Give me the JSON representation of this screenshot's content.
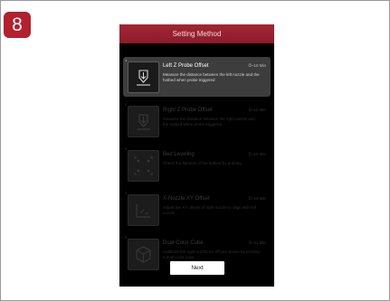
{
  "step_badge": "8",
  "colors": {
    "accent": "#b3202e",
    "topbar": "#9e2232",
    "device_bg": "#000000",
    "active_item": "#3d3d3d"
  },
  "screen": {
    "title": "Setting Method",
    "items": [
      {
        "number": "1",
        "title": "Left Z Probe Offset",
        "time": "⏱~10 Min",
        "description": "Measure the distance between the left nozzle and the hotbed when probe triggered",
        "icon": "probe-offset-icon",
        "active": true
      },
      {
        "number": "2",
        "title": "Right Z Probe Offset",
        "time": "⏱~10 Min",
        "description": "Measure the distance between the right nozzle and the hotbed when probe triggered",
        "icon": "probe-offset-icon",
        "active": false
      },
      {
        "number": "3",
        "title": "Bed Leveling",
        "time": "⏱~10 Min",
        "description": "Check the flatness of the hotbed by probing",
        "icon": "bed-leveling-icon",
        "active": false
      },
      {
        "number": "4",
        "title": "X-Nozzle XY Offset",
        "time": "⏱~15 Min",
        "description": "Adjust the XY offsets of right nozzle to align with left nozzle",
        "icon": "xy-offset-icon",
        "active": false
      },
      {
        "number": "5",
        "title": "Dual-Color Cube",
        "time": "⏱~11 Min",
        "description": "Calibrate the right nozzle for offsets issues by printing a dual-color cube",
        "icon": "cube-icon",
        "active": false
      }
    ],
    "next_label": "Next"
  }
}
